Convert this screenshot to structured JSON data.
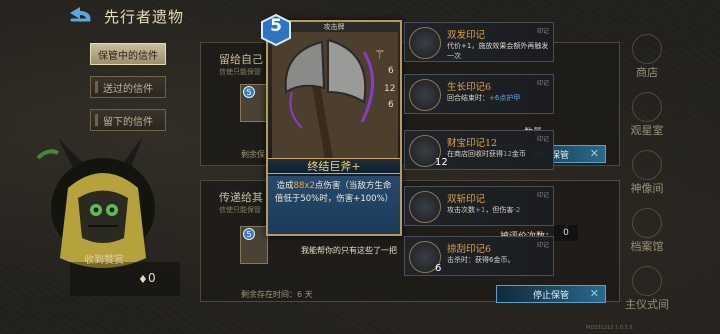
{
  "header": {
    "title": "先行者遗物"
  },
  "tabs": [
    {
      "label": "保管中的信件",
      "active": true
    },
    {
      "label": "送过的信件",
      "active": false
    },
    {
      "label": "留下的信件",
      "active": false
    }
  ],
  "character": {
    "reward_label": "收到赞赏",
    "reward_value": "0"
  },
  "letters": [
    {
      "title": "留给自己",
      "subtitle": "信使只能保管",
      "remain": "剩余保",
      "badge": "5"
    },
    {
      "title": "传递给其",
      "subtitle": "信使只能保管",
      "badge": "5",
      "message": "我能帮你的只有这些了一把",
      "remain": "剩余存在时间：6 天"
    }
  ],
  "weapon_card": {
    "cost": "5",
    "type": "攻击牌",
    "name": "终结巨斧+",
    "desc_pre": "造成",
    "desc_value": "88x2",
    "desc_mid": "点伤害（当敌方生命值低于50%时，伤害+100%）",
    "rune_numbers": [
      "6",
      "12",
      "6"
    ]
  },
  "seals": [
    {
      "name": "双发印记",
      "tag": "印记",
      "desc": "代价+1，施放效果会额外再触发一次",
      "count": ""
    },
    {
      "name": "生长印记6",
      "tag": "印记",
      "desc_pre": "回合结束时：",
      "desc_hl": "+6点护甲",
      "count": ""
    },
    {
      "name": "财宝印记12",
      "tag": "印记",
      "desc_pre": "在商店回收时获得",
      "desc_hl": "12",
      "desc_post": "金币",
      "count": "12"
    },
    {
      "name": "双斩印记",
      "tag": "印记",
      "desc_pre": "攻击次数",
      "desc_hl": "+1",
      "desc_mid": "，但伤害",
      "desc_hl2": "-2",
      "count": ""
    },
    {
      "name": "掠刮印记6",
      "tag": "印记",
      "desc": "击杀时：获得6金币。",
      "count": "6"
    }
  ],
  "buttons": {
    "stop_keep_1": "停止保管",
    "stop_keep_2": "停止保管"
  },
  "misc": {
    "label_a": "数量",
    "label_b": "被评价次数：",
    "label_b_value": "0"
  },
  "nav": [
    "商店",
    "观星室",
    "神像间",
    "档案馆",
    "主仪式间"
  ],
  "version": "PID231213 1.0.5.5"
}
